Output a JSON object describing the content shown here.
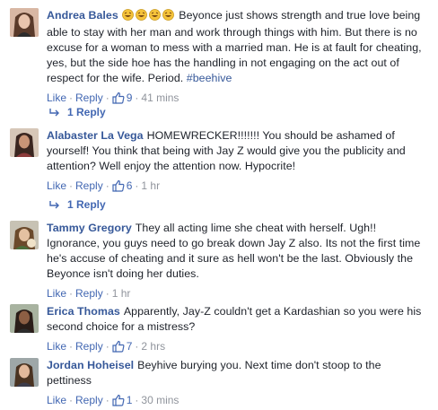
{
  "comments": [
    {
      "author": "Andrea Bales",
      "emoji": [
        "😂",
        "😂",
        "😂",
        "😂"
      ],
      "text": "Beyonce just shows strength and true love being able to stay with her man and work through things with him. But there is no excuse for a woman to mess with a married man. He is at fault for cheating, yes, but the side hoe has the handling in not engaging on the act out of respect for the wife. Period.",
      "hashtag": "#beehive",
      "like_label": "Like",
      "reply_label": "Reply",
      "likes": "9",
      "time": "41 mins",
      "replies_label": "1 Reply"
    },
    {
      "author": "Alabaster La Vega",
      "text": "HOMEWRECKER!!!!!!! You should be ashamed of yourself! You think that being with Jay Z would give you the publicity and attention? Well enjoy the attention now. Hypocrite!",
      "like_label": "Like",
      "reply_label": "Reply",
      "likes": "6",
      "time": "1 hr",
      "replies_label": "1 Reply"
    },
    {
      "author": "Tammy Gregory",
      "text": "They all acting lime she cheat with herself. Ugh!! Ignorance, you guys need to go break down Jay Z also. Its not the first time he's accuse of cheating and it sure as hell won't be the last. Obviously the Beyonce isn't doing her duties.",
      "like_label": "Like",
      "reply_label": "Reply",
      "time": "1 hr"
    },
    {
      "author": "Erica Thomas",
      "text": "Apparently, Jay-Z couldn't get a Kardashian so you were his second choice for a mistress?",
      "like_label": "Like",
      "reply_label": "Reply",
      "likes": "7",
      "time": "2 hrs"
    },
    {
      "author": "Jordan Hoheisel",
      "text": "Beyhive burying you. Next time don't stoop to the pettiness",
      "like_label": "Like",
      "reply_label": "Reply",
      "likes": "1",
      "time": "30 mins"
    }
  ],
  "separator": "·",
  "colors": {
    "link": "#4267b2",
    "author": "#365899",
    "meta": "#90949c",
    "text": "#1d2129"
  }
}
